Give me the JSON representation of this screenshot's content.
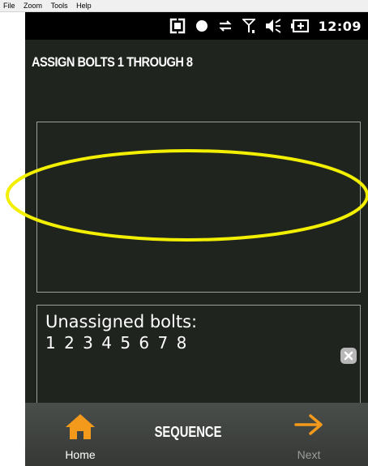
{
  "menubar": {
    "items": [
      "File",
      "Zoom",
      "Tools",
      "Help"
    ]
  },
  "statusbar": {
    "time": "12:09",
    "icons": [
      "sync-icon",
      "record-dot-icon",
      "data-transfer-icon",
      "signal-icon",
      "volume-icon",
      "battery-icon"
    ]
  },
  "page": {
    "title": "ASSIGN BOLTS 1 THROUGH 8"
  },
  "unassigned": {
    "label": "Unassigned bolts:",
    "bolts": "1 2 3 4 5 6 7 8"
  },
  "bottom_nav": {
    "home_label": "Home",
    "title": "SEQUENCE",
    "next_label": "Next"
  },
  "colors": {
    "background": "#1f241f",
    "accent_orange": "#f39a1c",
    "highlight_yellow": "#f2ef00",
    "disabled_text": "#9a9e9a"
  }
}
